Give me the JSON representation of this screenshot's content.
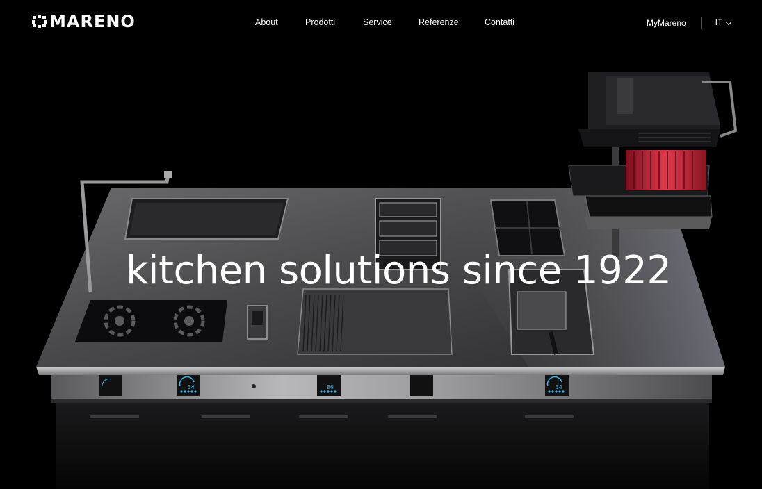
{
  "brand": {
    "name": "MARENO"
  },
  "nav": {
    "items": [
      {
        "label": "About"
      },
      {
        "label": "Prodotti"
      },
      {
        "label": "Service"
      },
      {
        "label": "Referenze"
      },
      {
        "label": "Contatti"
      }
    ],
    "account_label": "MyMareno",
    "language": "IT"
  },
  "hero": {
    "headline": "kitchen solutions since 1922",
    "display_readings": [
      "34",
      "86",
      "34"
    ]
  },
  "colors": {
    "background": "#000000",
    "text": "#ffffff",
    "grill_accent": "#c8283c",
    "display_accent": "#3fb6e8"
  }
}
